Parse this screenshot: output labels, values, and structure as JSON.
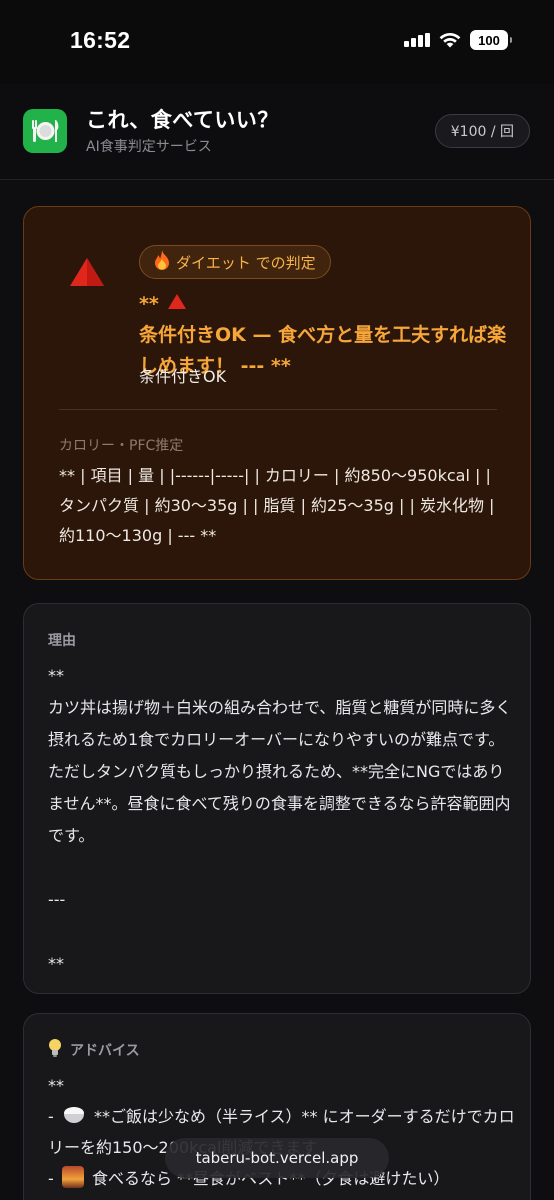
{
  "status_bar": {
    "time": "16:52",
    "battery": "100"
  },
  "header": {
    "title": "これ、食べていい？",
    "subtitle": "AI食事判定サービス",
    "price": "¥100 / 回",
    "icon": "plate-fork-knife-icon"
  },
  "verdict": {
    "mode_label": "ダイエット での判定",
    "heading_prefix": "**",
    "heading_text": "条件付きOK — 食べ方と量を工夫すれば楽しめます！ --- **",
    "label": "条件付きOK",
    "pfc_title": "カロリー・PFC推定",
    "pfc_body": "** | 項目 | 量 | |------|-----| | カロリー | 約850〜950kcal | | タンパク質 | 約30〜35g | | 脂質 | 約25〜35g | | 炭水化物 | 約110〜130g | --- **",
    "accent_color": "#f7a63a"
  },
  "reason": {
    "title": "理由",
    "lines": [
      "**",
      "カツ丼は揚げ物＋白米の組み合わせで、脂質と糖質が同時に多く摂れるため1食でカロリーオーバーになりやすいのが難点です。ただしタンパク質もしっかり摂れるため、**完全にNGではありません**。昼食に食べて残りの食事を調整できるなら許容範囲内です。",
      "",
      "---",
      "",
      "**"
    ]
  },
  "advice": {
    "title": "アドバイス",
    "line1": "**",
    "item1_prefix": "-",
    "item1_text": "**ご飯は少なめ（半ライス）** にオーダーするだけでカロリーを約150〜200kcal削減できます",
    "item2_prefix": "-",
    "item2_text": "食べるなら **昼食がベスト**（夕食は避けたい）"
  },
  "url": "taberu-bot.vercel.app"
}
